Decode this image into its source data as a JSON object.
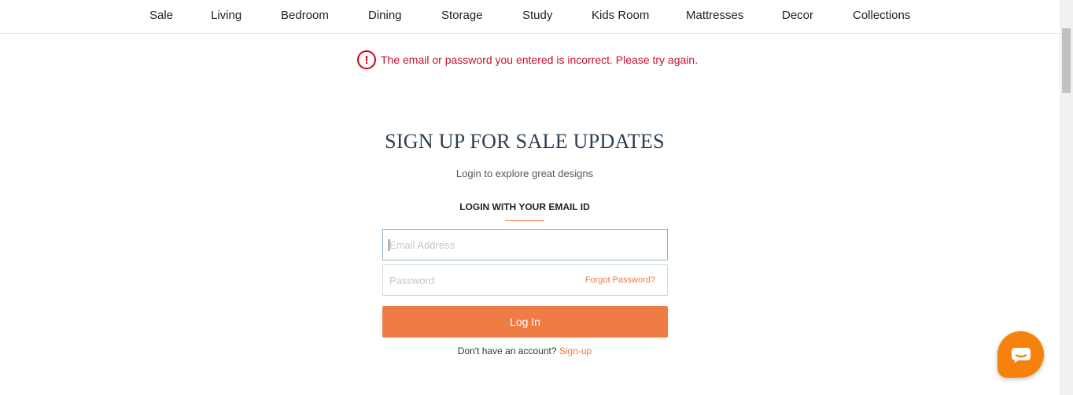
{
  "nav": {
    "items": [
      {
        "label": "Sale"
      },
      {
        "label": "Living"
      },
      {
        "label": "Bedroom"
      },
      {
        "label": "Dining"
      },
      {
        "label": "Storage"
      },
      {
        "label": "Study"
      },
      {
        "label": "Kids Room"
      },
      {
        "label": "Mattresses"
      },
      {
        "label": "Decor"
      },
      {
        "label": "Collections"
      }
    ]
  },
  "error": {
    "icon": "exclamation-circle-icon",
    "icon_glyph": "!",
    "message": "The email or password you entered is incorrect. Please try again.",
    "color": "#c8102e"
  },
  "form": {
    "heading": "SIGN UP FOR SALE UPDATES",
    "subheading": "Login to explore great designs",
    "section_label": "LOGIN WITH YOUR EMAIL ID",
    "email": {
      "placeholder": "Email Address",
      "value": ""
    },
    "password": {
      "placeholder": "Password",
      "value": ""
    },
    "forgot_label": "Forgot Password?",
    "login_label": "Log In",
    "signup_prompt": "Don't have an account?",
    "signup_label": "Sign-up"
  },
  "colors": {
    "accent": "#ef7b45",
    "chat_button": "#f5820d",
    "heading": "#2d3e50"
  },
  "chat": {
    "icon": "chat-bubble-icon"
  }
}
